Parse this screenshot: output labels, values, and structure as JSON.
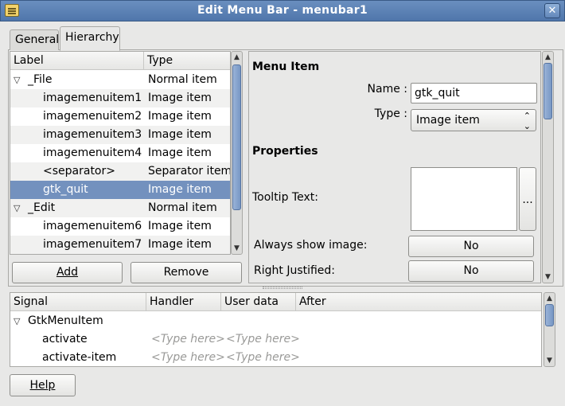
{
  "window": {
    "title": "Edit Menu Bar - menubar1",
    "close_glyph": "✕"
  },
  "tabs": [
    {
      "label": "General"
    },
    {
      "label": "Hierarchy",
      "active": true
    }
  ],
  "hierarchy": {
    "columns": {
      "label": "Label",
      "type": "Type"
    },
    "rows": [
      {
        "label": "_File",
        "type": "Normal item",
        "expander": "▽"
      },
      {
        "label": "imagemenuitem1",
        "type": "Image item"
      },
      {
        "label": "imagemenuitem2",
        "type": "Image item"
      },
      {
        "label": "imagemenuitem3",
        "type": "Image item"
      },
      {
        "label": "imagemenuitem4",
        "type": "Image item"
      },
      {
        "label": "<separator>",
        "type": "Separator item"
      },
      {
        "label": "gtk_quit",
        "type": "Image item",
        "selected": true
      },
      {
        "label": "_Edit",
        "type": "Normal item",
        "expander": "▽"
      },
      {
        "label": "imagemenuitem6",
        "type": "Image item"
      },
      {
        "label": "imagemenuitem7",
        "type": "Image item"
      }
    ],
    "add_button": "Add",
    "remove_button": "Remove"
  },
  "properties": {
    "menu_item_heading": "Menu Item",
    "name_label": "Name :",
    "name_value": "gtk_quit",
    "type_label": "Type :",
    "type_value": "Image item",
    "properties_heading": "Properties",
    "tooltip_label": "Tooltip Text:",
    "tooltip_value": "",
    "ellipsis_button": "...",
    "always_show_image_label": "Always show image:",
    "always_show_image_value": "No",
    "right_justified_label": "Right Justified:",
    "right_justified_value": "No"
  },
  "signals": {
    "columns": {
      "signal": "Signal",
      "handler": "Handler",
      "user_data": "User data",
      "after": "After"
    },
    "group": {
      "name": "GtkMenuItem",
      "expander": "▽"
    },
    "rows": [
      {
        "signal": "activate",
        "handler": "<Type here>",
        "user_data": "<Type here>"
      },
      {
        "signal": "activate-item",
        "handler": "<Type here>",
        "user_data": "<Type here>"
      }
    ]
  },
  "help_button": "Help",
  "colors": {
    "selection": "#7391be",
    "titlebar": "#5a80b3"
  }
}
